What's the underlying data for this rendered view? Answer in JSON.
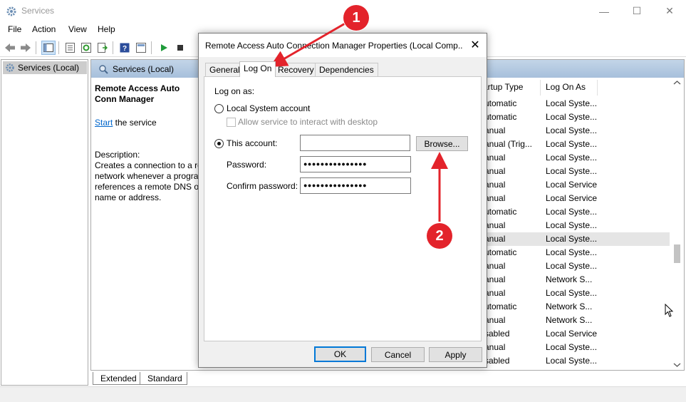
{
  "window": {
    "title": "Services",
    "menu": [
      "File",
      "Action",
      "View",
      "Help"
    ]
  },
  "tree": {
    "item": "Services (Local)"
  },
  "pane": {
    "header": "Services (Local)",
    "service_name": "Remote Access Auto Conn Manager",
    "start_link": "Start",
    "start_suffix": " the service",
    "description_label": "Description:",
    "description_text": "Creates a connection to a re network whenever a prograr references a remote DNS or name or address."
  },
  "columns": {
    "startup": "artup Type",
    "logon": "Log On As"
  },
  "rows": [
    {
      "startup": "utomatic",
      "logon": "Local Syste..."
    },
    {
      "startup": "utomatic",
      "logon": "Local Syste..."
    },
    {
      "startup": "anual",
      "logon": "Local Syste..."
    },
    {
      "startup": "anual (Trig...",
      "logon": "Local Syste..."
    },
    {
      "startup": "anual",
      "logon": "Local Syste..."
    },
    {
      "startup": "anual",
      "logon": "Local Syste..."
    },
    {
      "startup": "anual",
      "logon": "Local Service"
    },
    {
      "startup": "anual",
      "logon": "Local Service"
    },
    {
      "startup": "utomatic",
      "logon": "Local Syste..."
    },
    {
      "startup": "anual",
      "logon": "Local Syste..."
    },
    {
      "startup": "anual",
      "logon": "Local Syste...",
      "selected": true
    },
    {
      "startup": "utomatic",
      "logon": "Local Syste..."
    },
    {
      "startup": "anual",
      "logon": "Local Syste..."
    },
    {
      "startup": "anual",
      "logon": "Network S..."
    },
    {
      "startup": "anual",
      "logon": "Local Syste..."
    },
    {
      "startup": "utomatic",
      "logon": "Network S..."
    },
    {
      "startup": "anual",
      "logon": "Network S..."
    },
    {
      "startup": "sabled",
      "logon": "Local Service"
    },
    {
      "startup": "anual",
      "logon": "Local Syste..."
    },
    {
      "startup": "sabled",
      "logon": "Local Syste..."
    }
  ],
  "view_tabs": {
    "extended": "Extended",
    "standard": "Standard"
  },
  "dialog": {
    "title": "Remote Access Auto Connection Manager Properties (Local Comp...",
    "tabs": [
      "General",
      "Log On",
      "Recovery",
      "Dependencies"
    ],
    "active_tab": "Log On",
    "logon_as_label": "Log on as:",
    "local_system_label": "Local System account",
    "allow_desktop_label": "Allow service to interact with desktop",
    "this_account_label": "This account:",
    "account_value": "",
    "password_label": "Password:",
    "password_value": "●●●●●●●●●●●●●●●",
    "confirm_label": "Confirm password:",
    "confirm_value": "●●●●●●●●●●●●●●●",
    "browse_label": "Browse...",
    "ok_label": "OK",
    "cancel_label": "Cancel",
    "apply_label": "Apply",
    "selected_option": "This account"
  },
  "annotations": {
    "marker1": "1",
    "marker2": "2",
    "color": "#e3232b"
  },
  "colors": {
    "pane_header": "#b4c9e1",
    "accent": "#0078d7"
  }
}
